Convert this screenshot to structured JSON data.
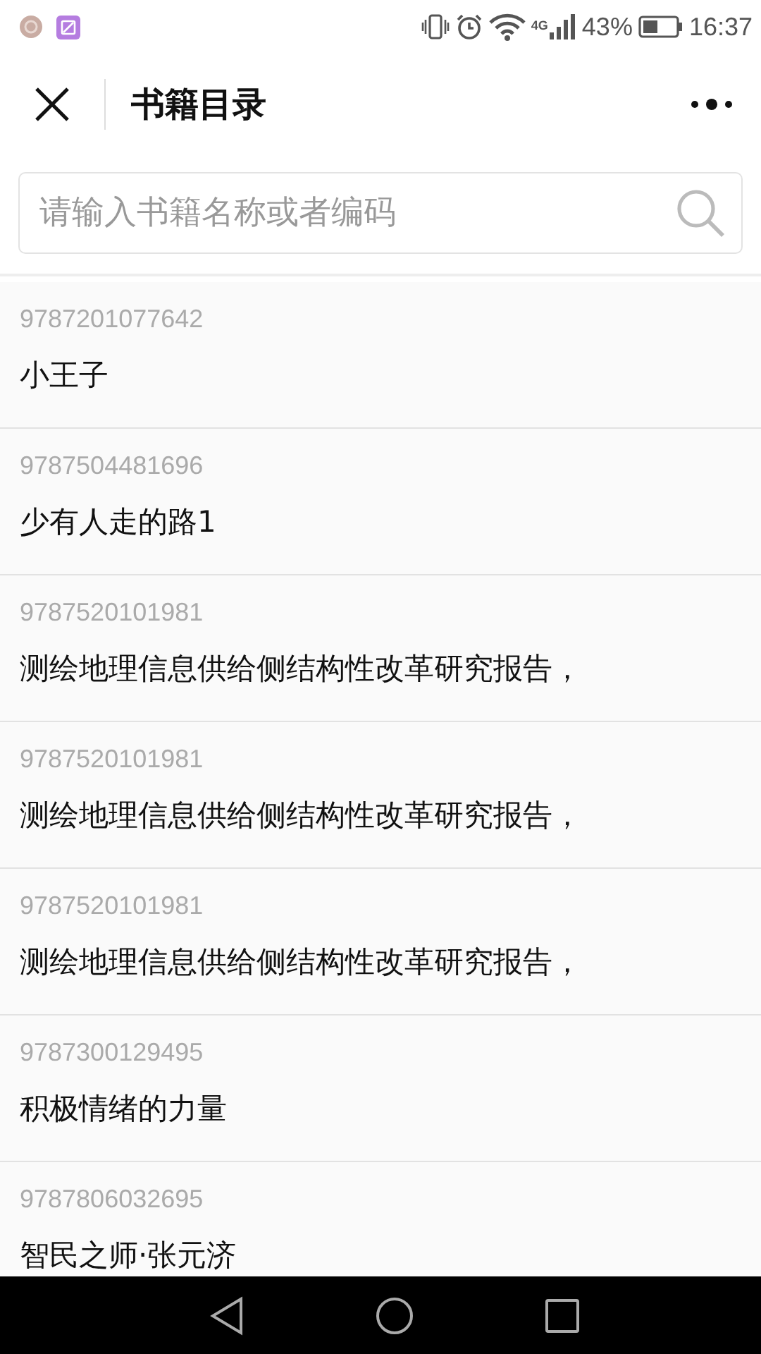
{
  "status_bar": {
    "battery_text": "43%",
    "network": "4G",
    "time": "16:37"
  },
  "header": {
    "title": "书籍目录"
  },
  "search": {
    "placeholder": "请输入书籍名称或者编码"
  },
  "books": [
    {
      "code": "9787201077642",
      "title": "小王子"
    },
    {
      "code": "9787504481696",
      "title": "少有人走的路1"
    },
    {
      "code": "9787520101981",
      "title": "测绘地理信息供给侧结构性改革研究报告，"
    },
    {
      "code": "9787520101981",
      "title": "测绘地理信息供给侧结构性改革研究报告，"
    },
    {
      "code": "9787520101981",
      "title": "测绘地理信息供给侧结构性改革研究报告，"
    },
    {
      "code": "9787300129495",
      "title": "积极情绪的力量"
    },
    {
      "code": "9787806032695",
      "title": "智民之师·张元济"
    }
  ]
}
